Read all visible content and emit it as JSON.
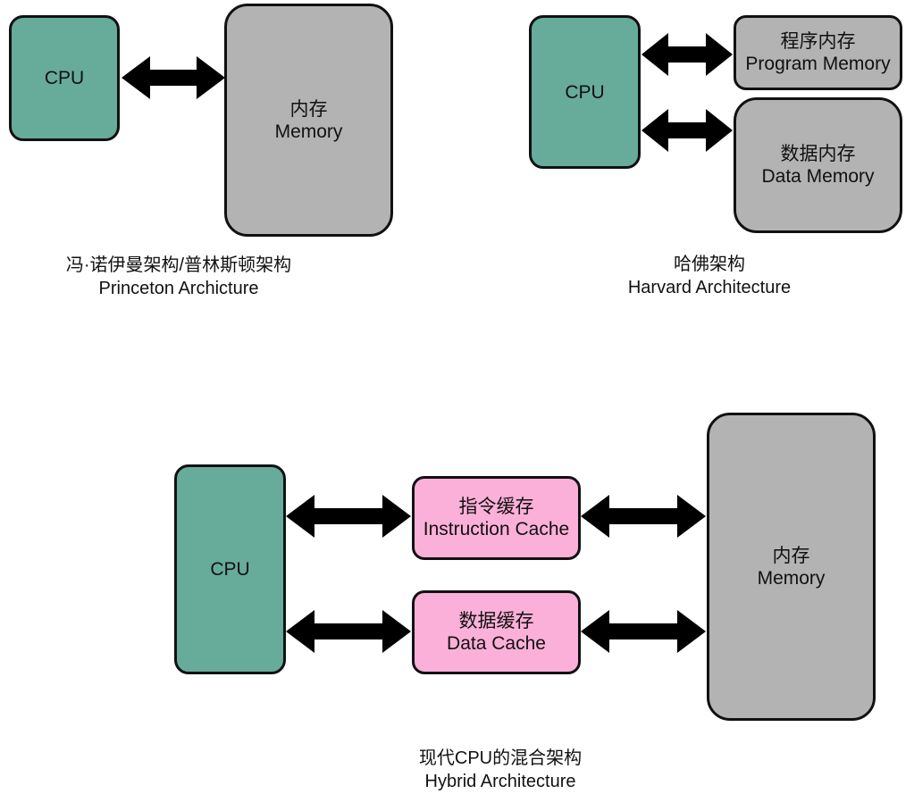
{
  "princeton": {
    "cpu_label": "CPU",
    "memory_cn": "内存",
    "memory_en": "Memory",
    "caption_cn": "冯·诺伊曼架构/普林斯顿架构",
    "caption_en": "Princeton Archicture"
  },
  "harvard": {
    "cpu_label": "CPU",
    "program_memory_cn": "程序内存",
    "program_memory_en": "Program Memory",
    "data_memory_cn": "数据内存",
    "data_memory_en": "Data Memory",
    "caption_cn": "哈佛架构",
    "caption_en": "Harvard Architecture"
  },
  "hybrid": {
    "cpu_label": "CPU",
    "instruction_cache_cn": "指令缓存",
    "instruction_cache_en": "Instruction Cache",
    "data_cache_cn": "数据缓存",
    "data_cache_en": "Data Cache",
    "memory_cn": "内存",
    "memory_en": "Memory",
    "caption_cn": "现代CPU的混合架构",
    "caption_en": "Hybrid Architecture"
  },
  "colors": {
    "cpu": "#67ab9b",
    "memory": "#b3b3b3",
    "cache": "#fbb0d9",
    "arrow": "#000000"
  }
}
